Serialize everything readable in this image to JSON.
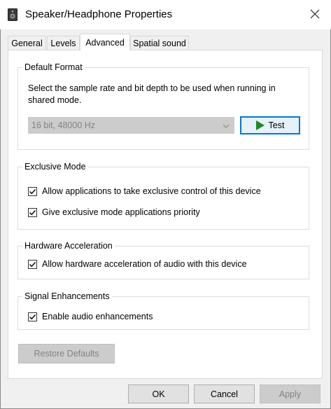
{
  "window": {
    "title": "Speaker/Headphone Properties"
  },
  "tabs": [
    {
      "label": "General"
    },
    {
      "label": "Levels"
    },
    {
      "label": "Advanced"
    },
    {
      "label": "Spatial sound"
    }
  ],
  "default_format": {
    "legend": "Default Format",
    "description_line1": "Select the sample rate and bit depth to be used when running in",
    "description_line2": "shared mode.",
    "selected_format": "16 bit, 48000 Hz",
    "test_label": "Test"
  },
  "exclusive_mode": {
    "legend": "Exclusive Mode",
    "allow_exclusive_control": "Allow applications to take exclusive control of this device",
    "give_priority": "Give exclusive mode applications priority"
  },
  "hardware_acceleration": {
    "legend": "Hardware Acceleration",
    "allow_hw_accel": "Allow hardware acceleration of audio with this device"
  },
  "signal_enhancements": {
    "legend": "Signal Enhancements",
    "enable_enhancements": "Enable audio enhancements"
  },
  "restore_defaults_label": "Restore Defaults",
  "buttons": {
    "ok": "OK",
    "cancel": "Cancel",
    "apply": "Apply"
  },
  "checked": {
    "allow_exclusive_control": true,
    "give_priority": true,
    "allow_hw_accel": true,
    "enable_enhancements": true
  }
}
